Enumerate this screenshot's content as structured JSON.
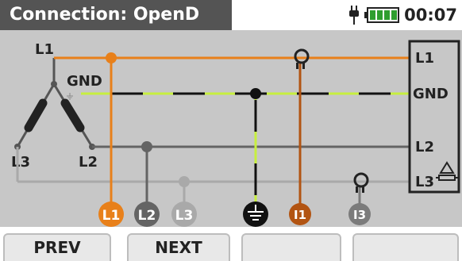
{
  "header": {
    "title": "Connection: OpenD",
    "time": "00:07",
    "plug_icon": "plug-icon",
    "battery_icon": "battery-full-icon",
    "battery_color": "#2e9e2e"
  },
  "source": {
    "l1": "L1",
    "gnd": "GND",
    "l3": "L3",
    "l2": "L2"
  },
  "terminal": {
    "l1": "L1",
    "gnd": "GND",
    "l2": "L2",
    "l3": "L3",
    "l3_icon": "ground-transformer-icon"
  },
  "badges": {
    "l1": "L1",
    "l2": "L2",
    "l3": "L3",
    "ground_icon": "ground-icon",
    "i1": "I1",
    "i3": "I3"
  },
  "colors": {
    "l1": "#e8801a",
    "l2": "#646464",
    "l3": "#a9a9a9",
    "gnd_stripe": "#c7ef3f",
    "i1": "#b25412",
    "i3": "#7b7b7b"
  },
  "softkeys": {
    "f1": "PREV",
    "f2": "NEXT",
    "f3": "",
    "f4": ""
  }
}
